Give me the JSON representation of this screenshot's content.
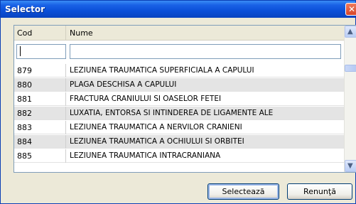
{
  "window": {
    "title": "Selector"
  },
  "columns": {
    "cod": "Cod",
    "nume": "Nume"
  },
  "filter": {
    "cod_value": "",
    "nume_value": ""
  },
  "rows": [
    {
      "cod": "879",
      "nume": "LEZIUNEA TRAUMATICA SUPERFICIALA A CAPULUI"
    },
    {
      "cod": "880",
      "nume": "PLAGA DESCHISA A CAPULUI"
    },
    {
      "cod": "881",
      "nume": "FRACTURA CRANIULUI SI OASELOR FETEI"
    },
    {
      "cod": "882",
      "nume": "LUXATIA, ENTORSA SI INTINDEREA DE LIGAMENTE ALE"
    },
    {
      "cod": "883",
      "nume": "LEZIUNEA TRAUMATICA A NERVILOR CRANIENI"
    },
    {
      "cod": "884",
      "nume": "LEZIUNEA TRAUMATICA A OCHIULUI SI ORBITEI"
    },
    {
      "cod": "885",
      "nume": "LEZIUNEA TRAUMATICA INTRACRANIANA"
    }
  ],
  "buttons": {
    "select": "Selectează",
    "cancel": "Renunţă"
  },
  "icons": {
    "close": "close-icon",
    "scroll_up": "chevron-up-icon",
    "scroll_down": "chevron-down-icon"
  },
  "colors": {
    "titlebar": "#0a4fd8",
    "window_bg": "#ece9d8",
    "row_alt": "#e4e4e4"
  }
}
